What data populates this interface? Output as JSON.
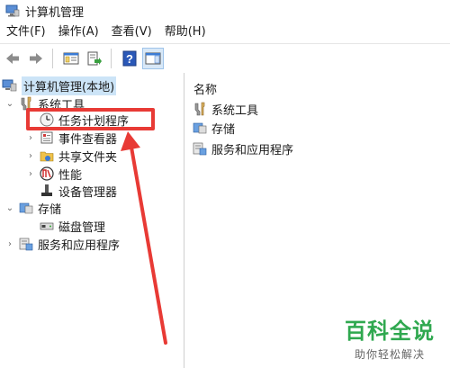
{
  "window": {
    "title": "计算机管理"
  },
  "menu": [
    "文件(F)",
    "操作(A)",
    "查看(V)",
    "帮助(H)"
  ],
  "tree": {
    "root": "计算机管理(本地)",
    "system_tools": "系统工具",
    "task_scheduler": "任务计划程序",
    "event_viewer": "事件查看器",
    "shared_folders": "共享文件夹",
    "performance": "性能",
    "device_manager": "设备管理器",
    "storage": "存储",
    "disk_management": "磁盘管理",
    "services_apps": "服务和应用程序"
  },
  "list": {
    "header": "名称",
    "items": [
      "系统工具",
      "存储",
      "服务和应用程序"
    ]
  },
  "watermark": {
    "main": "百科全说",
    "sub": "助你轻松解决"
  },
  "colors": {
    "highlight": "#e83a35",
    "selection": "#cce4f7",
    "watermark": "#2fa84f"
  }
}
